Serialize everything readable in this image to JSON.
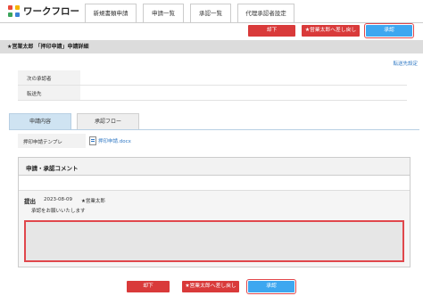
{
  "app": {
    "title": "ワークフロー"
  },
  "tabs": [
    {
      "label": "新規書類申請"
    },
    {
      "label": "申請一覧"
    },
    {
      "label": "承認一覧"
    },
    {
      "label": "代理承認者設定"
    }
  ],
  "actions": {
    "reject": "却下",
    "send_back": "★営業太郎へ差し戻し",
    "approve": "承認"
  },
  "detail": {
    "title": "★営業太郎 「押印申請」申請詳細",
    "forward_setting_link": "転送先設定"
  },
  "info": {
    "next_approver_label": "次の承認者",
    "forward_to_label": "転送先"
  },
  "content_tabs": [
    {
      "label": "申請内容"
    },
    {
      "label": "承認フロー"
    }
  ],
  "attachment": {
    "label": "押印申請テンプレ",
    "file": "押印申請.docx"
  },
  "comments": {
    "title": "申請・承認コメント",
    "entry": {
      "type": "提出",
      "date": "2023-08-09",
      "author": "★営業太郎",
      "text": "承認をお願いいたします"
    },
    "input_placeholder": ""
  },
  "colors": {
    "reject": "#d93a3a",
    "approve": "#3ea7f0",
    "highlight": "#e0474c",
    "section": "#dcdcdc"
  }
}
